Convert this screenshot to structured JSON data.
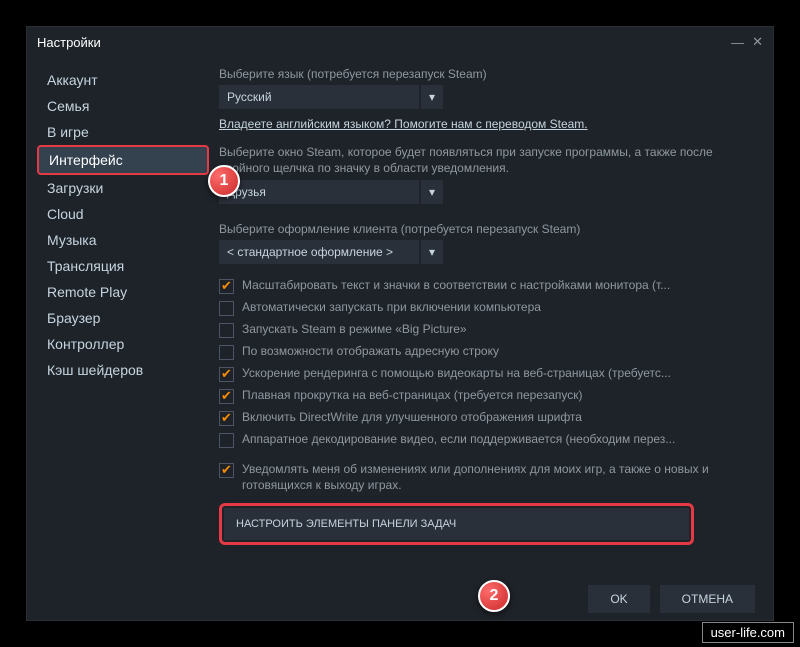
{
  "titlebar": {
    "title": "Настройки"
  },
  "sidebar": {
    "items": [
      {
        "label": "Аккаунт"
      },
      {
        "label": "Семья"
      },
      {
        "label": "В игре"
      },
      {
        "label": "Интерфейс",
        "selected": true
      },
      {
        "label": "Загрузки"
      },
      {
        "label": "Cloud"
      },
      {
        "label": "Музыка"
      },
      {
        "label": "Трансляция"
      },
      {
        "label": "Remote Play"
      },
      {
        "label": "Браузер"
      },
      {
        "label": "Контроллер"
      },
      {
        "label": "Кэш шейдеров"
      }
    ]
  },
  "main": {
    "lang_label": "Выберите язык (потребуется перезапуск Steam)",
    "lang_value": "Русский",
    "lang_link": "Владеете английским языком? Помогите нам с переводом Steam.",
    "window_label": "Выберите окно Steam, которое будет появляться при запуске программы, а также после двойного щелчка по значку в области уведомления.",
    "window_value": "Друзья",
    "skin_label": "Выберите оформление клиента (потребуется перезапуск Steam)",
    "skin_value": "< стандартное оформление >",
    "checks": [
      {
        "checked": true,
        "label": "Масштабировать текст и значки в соответствии с настройками монитора (т..."
      },
      {
        "checked": false,
        "label": "Автоматически запускать при включении компьютера"
      },
      {
        "checked": false,
        "label": "Запускать Steam в режиме «Big Picture»"
      },
      {
        "checked": false,
        "label": "По возможности отображать адресную строку"
      },
      {
        "checked": true,
        "label": "Ускорение рендеринга с помощью видеокарты на веб-страницах (требуетс..."
      },
      {
        "checked": true,
        "label": "Плавная прокрутка на веб-страницах (требуется перезапуск)"
      },
      {
        "checked": true,
        "label": "Включить DirectWrite для улучшенного отображения шрифта"
      },
      {
        "checked": false,
        "label": "Аппаратное декодирование видео, если поддерживается (необходим перез..."
      }
    ],
    "notify_checked": true,
    "notify_label": "Уведомлять меня об изменениях или дополнениях для моих игр, а также о новых и готовящихся к выходу играх.",
    "taskbar_btn": "НАСТРОИТЬ ЭЛЕМЕНТЫ ПАНЕЛИ ЗАДАЧ"
  },
  "footer": {
    "ok": "OK",
    "cancel": "ОТМЕНА"
  },
  "watermark": "user-life.com",
  "markers": {
    "m1": "1",
    "m2": "2"
  }
}
